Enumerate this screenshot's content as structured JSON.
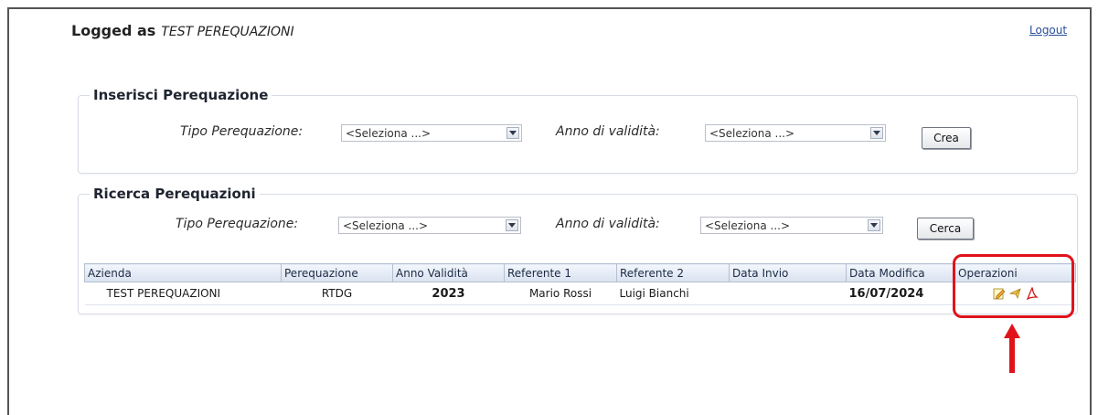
{
  "header": {
    "logged_label": "Logged as",
    "user": "TEST PEREQUAZIONI",
    "logout": "Logout"
  },
  "insert": {
    "legend": "Inserisci Perequazione",
    "tipo_label": "Tipo Perequazione:",
    "tipo_value": "<Seleziona ...>",
    "anno_label": "Anno di validità:",
    "anno_value": "<Seleziona ...>",
    "button": "Crea"
  },
  "search": {
    "legend": "Ricerca Perequazioni",
    "tipo_label": "Tipo Perequazione:",
    "tipo_value": "<Seleziona ...>",
    "anno_label": "Anno di validità:",
    "anno_value": "<Seleziona ...>",
    "button": "Cerca"
  },
  "table": {
    "columns": [
      "Azienda",
      "Perequazione",
      "Anno Validità",
      "Referente 1",
      "Referente 2",
      "Data Invio",
      "Data Modifica",
      "Operazioni"
    ],
    "rows": [
      {
        "azienda": "TEST PEREQUAZIONI",
        "perequazione": "RTDG",
        "anno": "2023",
        "referente1": "Mario Rossi",
        "referente2": "Luigi Bianchi",
        "data_invio": "",
        "data_modifica": "16/07/2024",
        "operations": [
          "edit-icon",
          "send-icon",
          "pdf-icon"
        ]
      }
    ]
  },
  "colors": {
    "highlight": "#e0131b",
    "link": "#2a4f9a",
    "header_bg": "#d9e2f0"
  }
}
